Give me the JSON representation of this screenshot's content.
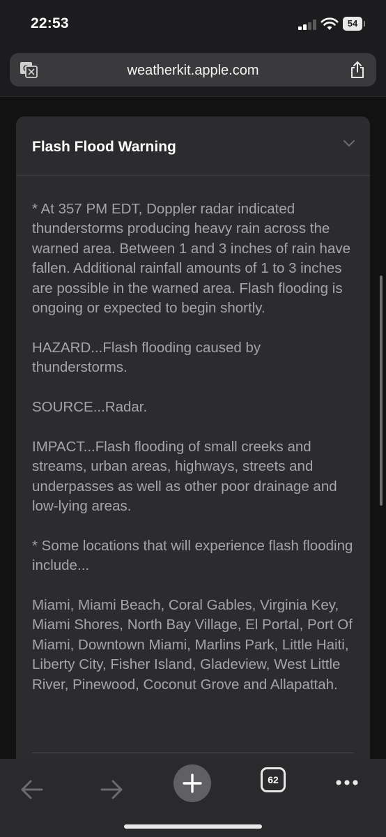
{
  "status_bar": {
    "time": "22:53",
    "battery": "54"
  },
  "browser": {
    "url": "weatherkit.apple.com",
    "tab_count": "62"
  },
  "alert": {
    "title": "Flash Flood Warning",
    "paragraphs": [
      "* At 357 PM EDT, Doppler radar indicated thunderstorms producing heavy rain across the warned area. Between 1 and 3 inches of rain have fallen. Additional rainfall amounts of 1 to 3 inches are possible in the warned area. Flash flooding is ongoing or expected to begin shortly.",
      "HAZARD...Flash flooding caused by thunderstorms.",
      "SOURCE...Radar.",
      "IMPACT...Flash flooding of small creeks and streams, urban areas, highways, streets and underpasses as well as other poor drainage and low-lying areas.",
      "* Some locations that will experience flash flooding include...",
      "Miami, Miami Beach, Coral Gables, Virginia Key, Miami Shores, North Bay Village, El Portal, Port Of Miami, Downtown Miami, Marlins Park, Little Haiti, Liberty City, Fisher Island, Gladeview, West Little River, Pinewood, Coconut Grove and Allapattah."
    ]
  },
  "colors": {
    "background": "#121212",
    "card": "#2c2c2e",
    "body_text": "#a5a5a8",
    "toolbar": "#2a2a2c"
  },
  "icons": {
    "translate": "translate-icon",
    "share": "share-icon",
    "chevron": "chevron-down-icon",
    "back": "back-arrow-icon",
    "forward": "forward-arrow-icon",
    "new_tab": "plus-icon",
    "menu": "more-dots-icon"
  }
}
